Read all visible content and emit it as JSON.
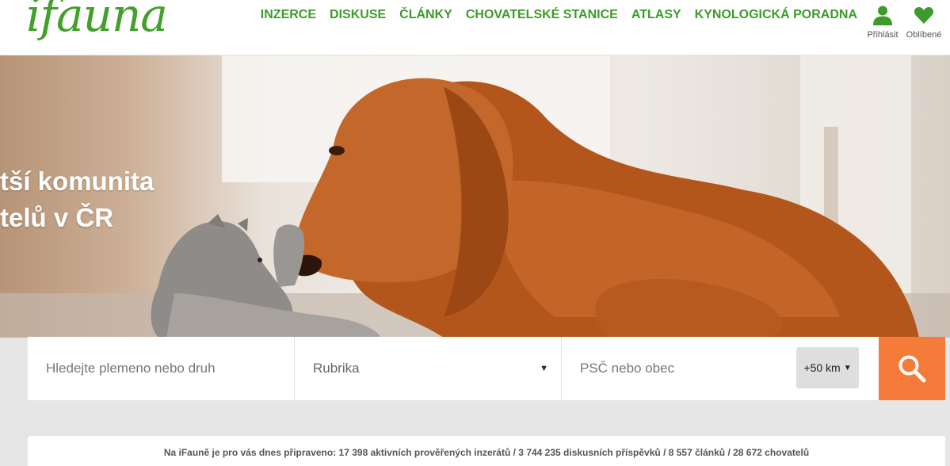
{
  "header": {
    "logo": "ifauna",
    "nav": [
      "INZERCE",
      "DISKUSE",
      "ČLÁNKY",
      "CHOVATELSKÉ STANICE",
      "ATLASY",
      "KYNOLOGICKÁ PORADNA"
    ],
    "login_label": "Přihlásit",
    "favorites_label": "Oblíbené"
  },
  "hero": {
    "line1": "tší komunita",
    "line2": "telů v ČR"
  },
  "search": {
    "query_placeholder": "Hledejte plemeno nebo druh",
    "category_label": "Rubrika",
    "location_placeholder": "PSČ nebo obec",
    "radius_label": "+50 km"
  },
  "stats": {
    "text": "Na iFauně je pro vás dnes připraveno: 17 398 aktivních prověřených inzerátů / 3 744 235 diskusních příspěvků / 8 557 článků / 28 672 chovatelů"
  },
  "colors": {
    "brand_green": "#43a02a",
    "accent_orange": "#f47b39"
  },
  "icons": [
    "user-icon",
    "heart-icon",
    "search-icon",
    "dropdown-arrow-icon"
  ]
}
